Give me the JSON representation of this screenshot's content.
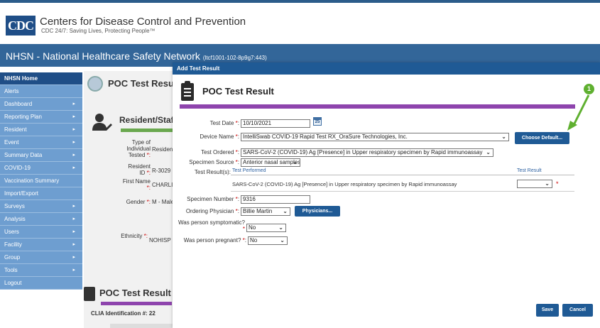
{
  "cdc": {
    "logo_text": "CDC",
    "name": "Centers for Disease Control and Prevention",
    "tagline": "CDC 24/7: Saving Lives, Protecting People™"
  },
  "nhsn": {
    "title": "NHSN - National Healthcare Safety Network",
    "host": "(ltcf1001-102-8p9g7:443)"
  },
  "sidebar": {
    "items": [
      {
        "label": "NHSN Home",
        "arrow": ""
      },
      {
        "label": "Alerts",
        "arrow": ""
      },
      {
        "label": "Dashboard",
        "arrow": "▸"
      },
      {
        "label": "Reporting Plan",
        "arrow": "▸"
      },
      {
        "label": "Resident",
        "arrow": "▸"
      },
      {
        "label": "Event",
        "arrow": "▸"
      },
      {
        "label": "Summary Data",
        "arrow": "▸"
      },
      {
        "label": "COVID-19",
        "arrow": "▸"
      },
      {
        "label": "Vaccination Summary",
        "arrow": ""
      },
      {
        "label": "Import/Export",
        "arrow": ""
      },
      {
        "label": "Surveys",
        "arrow": "▸"
      },
      {
        "label": "Analysis",
        "arrow": "▸"
      },
      {
        "label": "Users",
        "arrow": "▸"
      },
      {
        "label": "Facility",
        "arrow": "▸"
      },
      {
        "label": "Group",
        "arrow": "▸"
      },
      {
        "label": "Tools",
        "arrow": "▸"
      },
      {
        "label": "Logout",
        "arrow": ""
      }
    ]
  },
  "background": {
    "page_title": "POC Test Result R",
    "section_title": "Resident/Staf",
    "type_label": "Type of Individual Tested",
    "type_value": "Resident",
    "resident_id_label": "Resident ID",
    "resident_id_value": "R-3029",
    "first_name_label": "First Name",
    "first_name_value": "CHARLI",
    "gender_label": "Gender",
    "gender_value": "M - Male",
    "ethnicity_label": "Ethnicity",
    "ethnicity_value": "NOHISP",
    "section2_title": "POC Test Result",
    "clia_label": "CLIA Identification #: 22"
  },
  "modal": {
    "header": "Add Test Result",
    "title": "POC Test Result",
    "fields": {
      "test_date_label": "Test Date",
      "test_date_value": "10/10/2021",
      "device_name_label": "Device Name",
      "device_name_value": "IntelliSwab COVID-19 Rapid Test RX_OraSure Technologies, Inc.",
      "choose_default_label": "Choose Default...",
      "test_ordered_label": "Test Ordered",
      "test_ordered_value": "SARS-CoV-2 (COVID-19) Ag [Presence] in Upper respiratory specimen by Rapid immunoassay",
      "specimen_source_label": "Specimen Source",
      "specimen_source_value": "Anterior nasal samples",
      "test_results_label": "Test Result(s):",
      "col_test_performed": "Test Performed",
      "col_test_result": "Test Result",
      "row_test_performed": "SARS-CoV-2 (COVID-19) Ag [Presence] in Upper respiratory specimen by Rapid immunoassay",
      "row_test_result": "",
      "specimen_number_label": "Specimen Number",
      "specimen_number_value": "9316",
      "ordering_physician_label": "Ordering Physician",
      "ordering_physician_value": "Billie Martin",
      "physicians_button": "Physicians...",
      "symptomatic_label": "Was person symptomatic?",
      "symptomatic_value": "No",
      "pregnant_label": "Was person pregnant?",
      "pregnant_value": "No"
    },
    "save_label": "Save",
    "cancel_label": "Cancel"
  },
  "annotation": {
    "badge": "1"
  },
  "colors": {
    "brand_blue": "#336699",
    "dark_blue": "#1f5a95",
    "sidebar_blue": "#6e9ed0",
    "purple_rule": "#8e44ad",
    "required_red": "#cc0000",
    "annotation_green": "#5fb030"
  }
}
